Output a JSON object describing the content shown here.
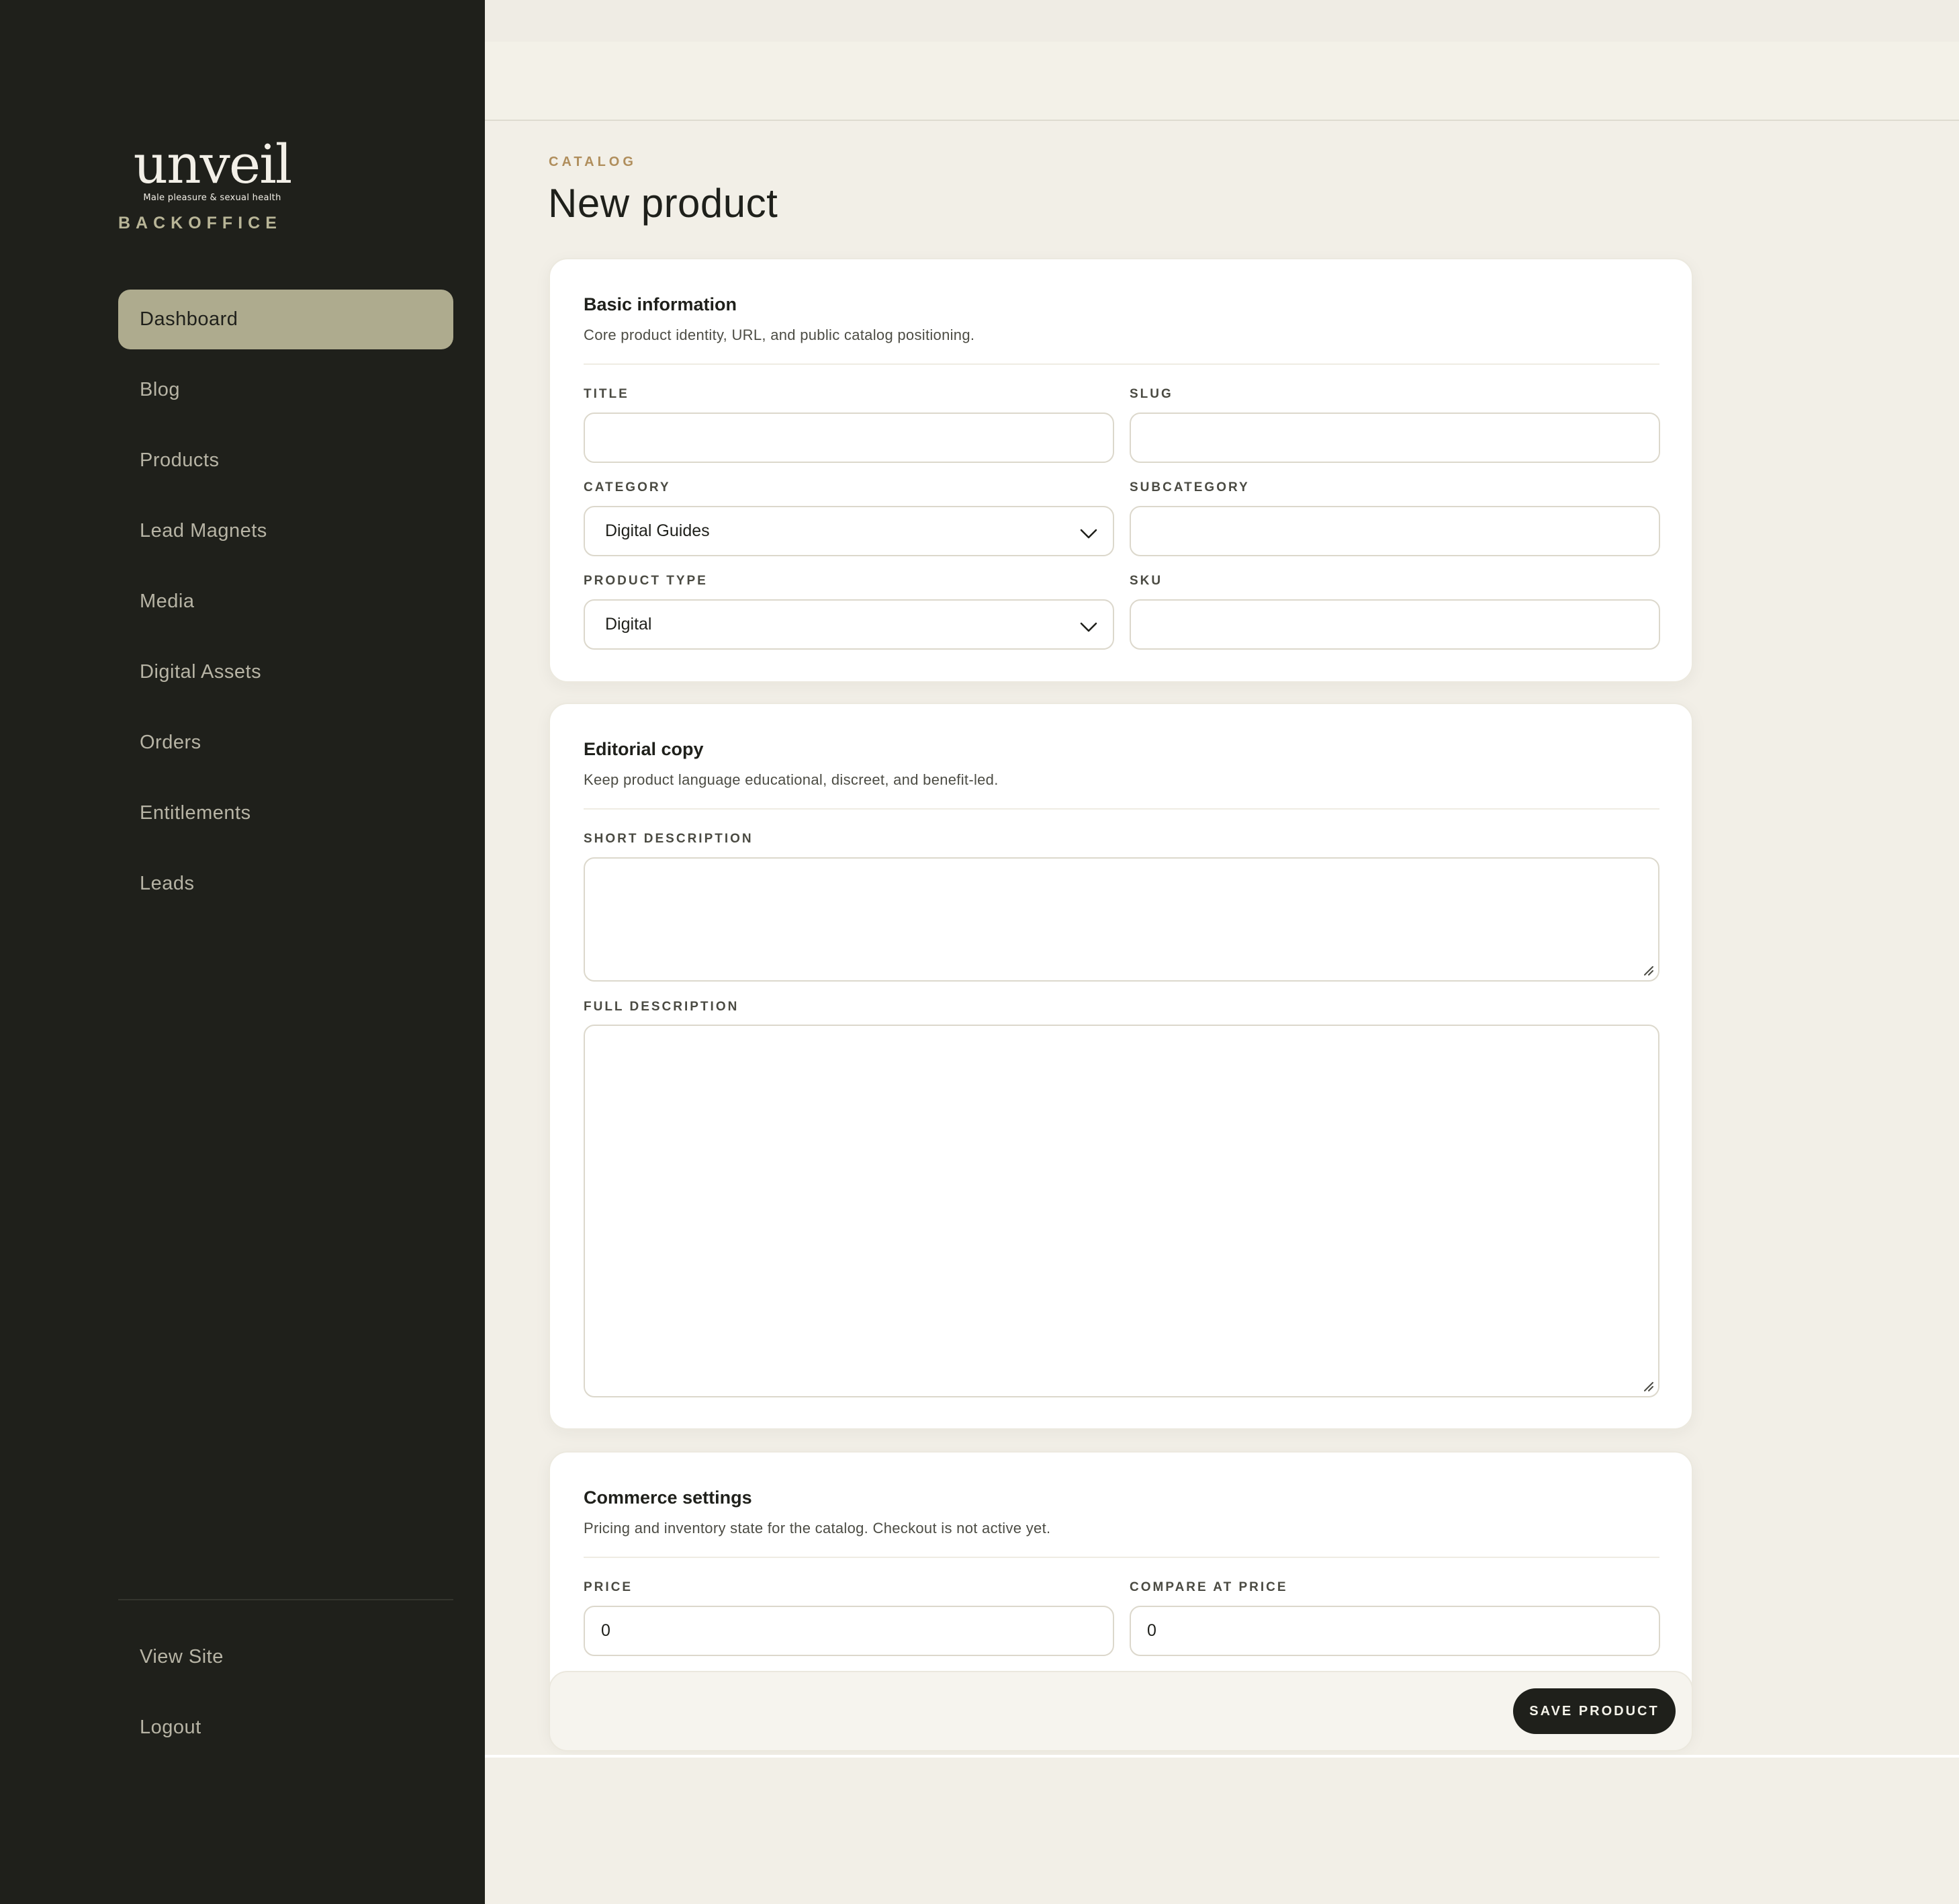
{
  "brand": {
    "logo_word": "unveil",
    "logo_tagline": "Male pleasure & sexual health",
    "section": "BACKOFFICE"
  },
  "sidebar": {
    "items": [
      {
        "label": "Dashboard",
        "active": true
      },
      {
        "label": "Blog"
      },
      {
        "label": "Products"
      },
      {
        "label": "Lead Magnets"
      },
      {
        "label": "Media"
      },
      {
        "label": "Digital Assets"
      },
      {
        "label": "Orders"
      },
      {
        "label": "Entitlements"
      },
      {
        "label": "Leads"
      }
    ],
    "bottom_items": [
      {
        "label": "View Site"
      },
      {
        "label": "Logout"
      }
    ]
  },
  "page": {
    "eyebrow": "CATALOG",
    "title": "New product"
  },
  "basic_info": {
    "title": "Basic information",
    "description": "Core product identity, URL, and public catalog positioning.",
    "title_label": "TITLE",
    "title_value": "",
    "slug_label": "SLUG",
    "slug_value": "",
    "category_label": "CATEGORY",
    "category_value": "Digital Guides",
    "subcategory_label": "SUBCATEGORY",
    "subcategory_value": "",
    "product_type_label": "PRODUCT TYPE",
    "product_type_value": "Digital",
    "sku_label": "SKU",
    "sku_value": ""
  },
  "editorial": {
    "title": "Editorial copy",
    "description": "Keep product language educational, discreet, and benefit-led.",
    "short_label": "SHORT DESCRIPTION",
    "full_label": "FULL DESCRIPTION"
  },
  "commerce": {
    "title": "Commerce settings",
    "description": "Pricing and inventory state for the catalog. Checkout is not active yet.",
    "price_label": "PRICE",
    "price_value": "0",
    "compare_label": "COMPARE AT PRICE",
    "compare_value": "0"
  },
  "actions": {
    "save_label": "SAVE PRODUCT"
  },
  "colors": {
    "sidebar_bg": "#1f201b",
    "active_nav": "#aeab8e",
    "accent_eyebrow": "#b08e5c",
    "page_bg": "#f2efe7"
  }
}
